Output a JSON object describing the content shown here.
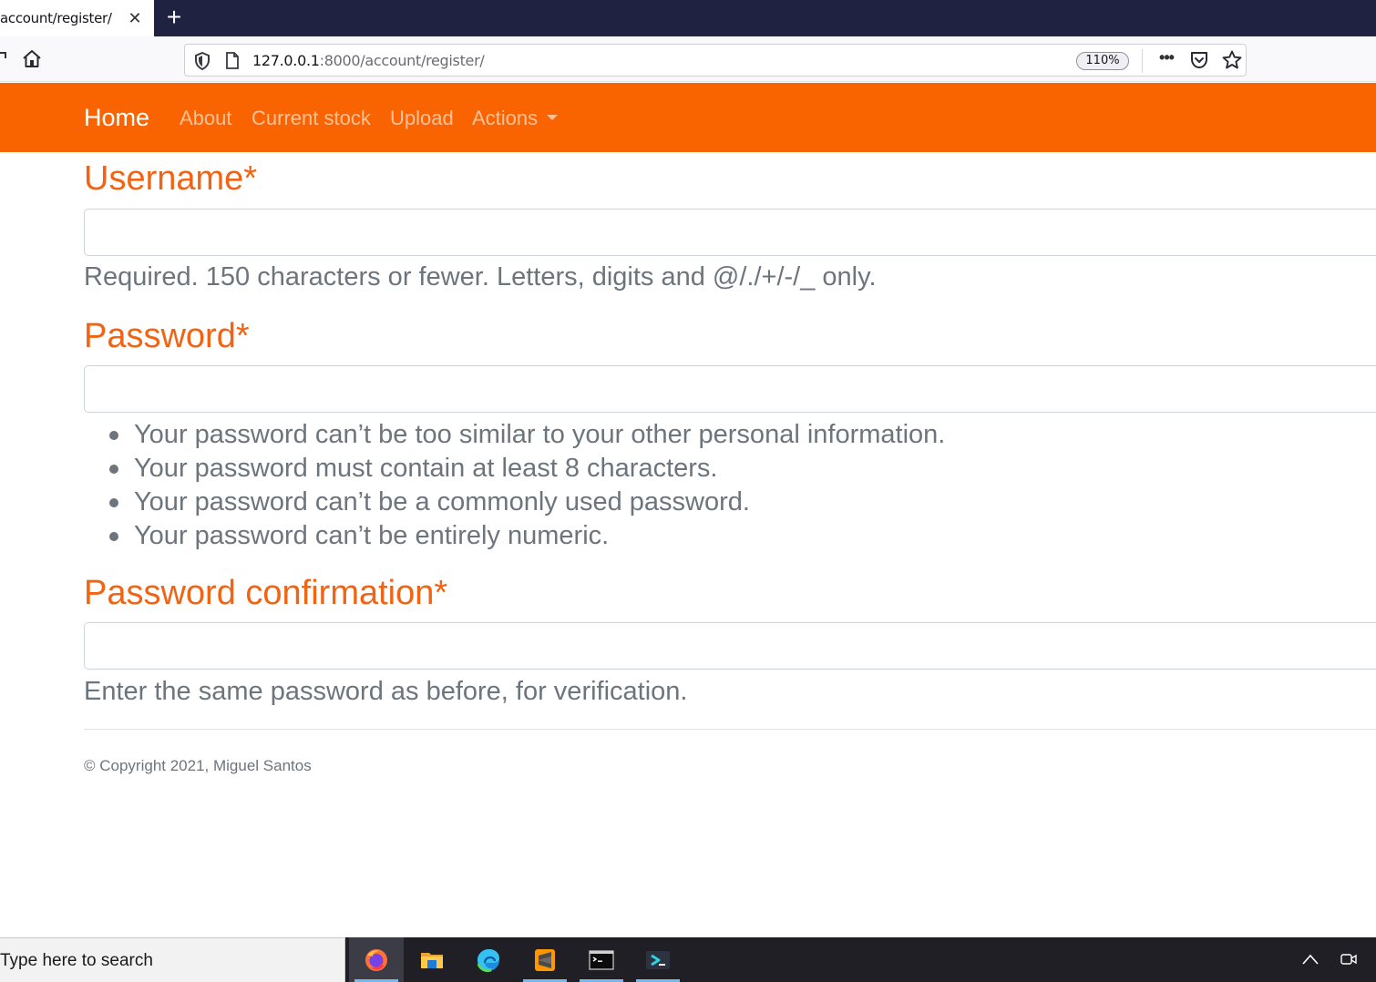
{
  "browser": {
    "tab_title": "account/register/",
    "tab_close": "✕",
    "new_tab": "+",
    "url_host": "127.0.0.1",
    "url_rest": ":8000/account/register/",
    "zoom": "110%",
    "more": "•••"
  },
  "site_nav": {
    "brand": "Home",
    "links": [
      "About",
      "Current stock",
      "Upload",
      "Actions"
    ]
  },
  "form": {
    "username_label": "Username*",
    "username_help": "Required. 150 characters or fewer. Letters, digits and @/./+/-/_ only.",
    "password_label": "Password*",
    "password_rules": [
      "Your password can’t be too similar to your other personal information.",
      "Your password must contain at least 8 characters.",
      "Your password can’t be a commonly used password.",
      "Your password can’t be entirely numeric."
    ],
    "confirm_label": "Password confirmation*",
    "confirm_help": "Enter the same password as before, for verification."
  },
  "footer": {
    "copyright": "© Copyright 2021, Miguel Santos"
  },
  "taskbar": {
    "search_placeholder": "Type here to search",
    "apps": [
      "firefox-icon",
      "file-explorer-icon",
      "edge-icon",
      "sublime-text-icon",
      "terminal-icon",
      "powershell-icon"
    ]
  },
  "colors": {
    "brand_orange": "#fa6400",
    "label_orange": "#f06414",
    "muted_text": "#6c757d"
  }
}
